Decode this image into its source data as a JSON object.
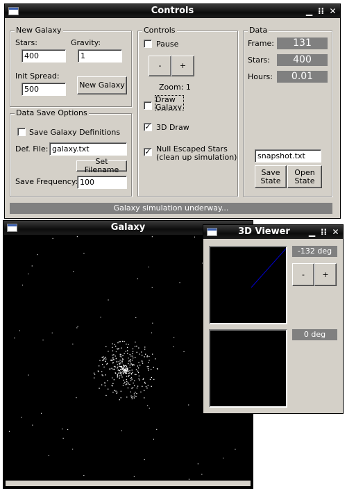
{
  "controls_window": {
    "title": "Controls",
    "title_buttons": {
      "minimize": "▁",
      "maximize": "⁞⁞",
      "close": "✕"
    },
    "new_galaxy": {
      "legend": "New Galaxy",
      "stars_label": "Stars:",
      "stars_value": "400",
      "gravity_label": "Gravity:",
      "gravity_value": "1",
      "spread_label": "Init Spread:",
      "spread_value": "500",
      "button": "New Galaxy"
    },
    "data_save": {
      "legend": "Data Save Options",
      "save_defs_label": "Save Galaxy Definitions",
      "save_defs_checked": false,
      "def_file_label": "Def. File:",
      "def_file_value": "galaxy.txt",
      "set_filename_button": "Set Filename",
      "save_freq_label": "Save Frequency:",
      "save_freq_value": "100"
    },
    "controls": {
      "legend": "Controls",
      "pause_label": "Pause",
      "pause_checked": false,
      "zoom_minus": "-",
      "zoom_plus": "+",
      "zoom_label": "Zoom: 1",
      "draw_galaxy_label": "Draw Galaxy",
      "draw_galaxy_checked": false,
      "draw3d_label": "3D Draw",
      "draw3d_checked": true,
      "null_escaped_line1": "Null Escaped Stars",
      "null_escaped_line2": "(clean up simulation)",
      "null_escaped_checked": true
    },
    "data": {
      "legend": "Data",
      "frame_label": "Frame:",
      "frame_value": "131",
      "stars_label": "Stars:",
      "stars_value": "400",
      "hours_label": "Hours:",
      "hours_value": "0.01",
      "snapshot_value": "snapshot.txt",
      "save_state_line1": "Save",
      "save_state_line2": "State",
      "open_state_line1": "Open",
      "open_state_line2": "State"
    },
    "status": "Galaxy simulation underway..."
  },
  "galaxy_window": {
    "title": "Galaxy",
    "star_color": "#ffffff",
    "background": "#000000"
  },
  "viewer_window": {
    "title": "3D Viewer",
    "title_buttons": {
      "minimize": "▁",
      "maximize": "⁞⁞",
      "close": "✕"
    },
    "angle1": "-132 deg",
    "angle2": "0 deg",
    "minus": "-",
    "plus": "+",
    "axis_color": "#0000cc"
  }
}
